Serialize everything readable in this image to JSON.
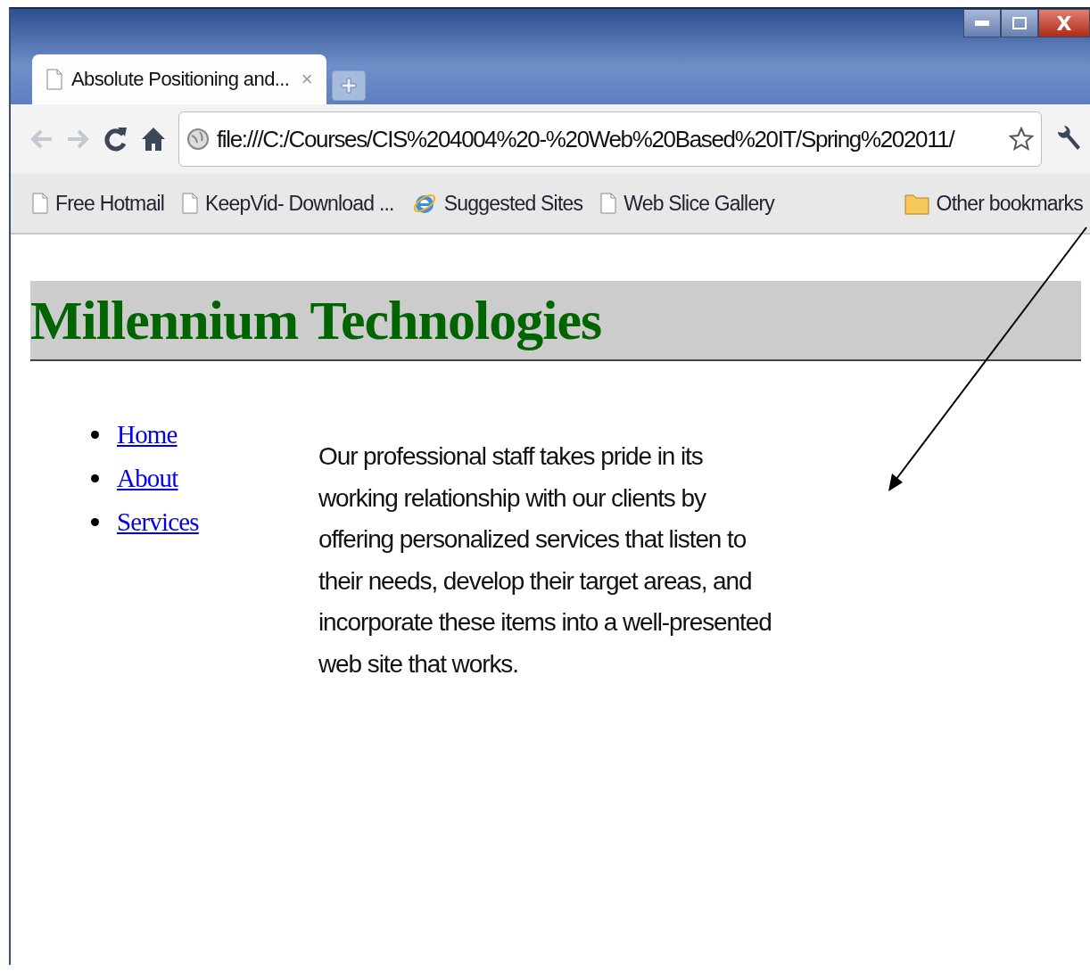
{
  "window": {
    "controls": [
      {
        "kind": "minimize"
      },
      {
        "kind": "maximize"
      },
      {
        "kind": "close",
        "label": "X"
      }
    ]
  },
  "tabs": [
    {
      "title": "Absolute Positioning and...",
      "close": "×",
      "selected": true
    }
  ],
  "toolbar": {
    "address": "file:///C:/Courses/CIS%204004%20-%20Web%20Based%20IT/Spring%202011/"
  },
  "bookmarks": [
    {
      "label": "Free Hotmail",
      "kind": "page"
    },
    {
      "label": "KeepVid- Download ...",
      "kind": "page"
    },
    {
      "label": "Suggested Sites",
      "kind": "ie"
    },
    {
      "label": "Web Slice Gallery",
      "kind": "page"
    }
  ],
  "other_bookmarks": {
    "label": "Other bookmarks"
  },
  "page": {
    "heading": "Millennium Technologies",
    "nav": [
      {
        "label": "Home"
      },
      {
        "label": "About"
      },
      {
        "label": "Services"
      }
    ],
    "paragraph": "Our professional staff takes pride in its working relationship with our clients by offering personalized services that listen to their needs, develop their target areas, and incorporate these items into a well-presented web site that works."
  }
}
